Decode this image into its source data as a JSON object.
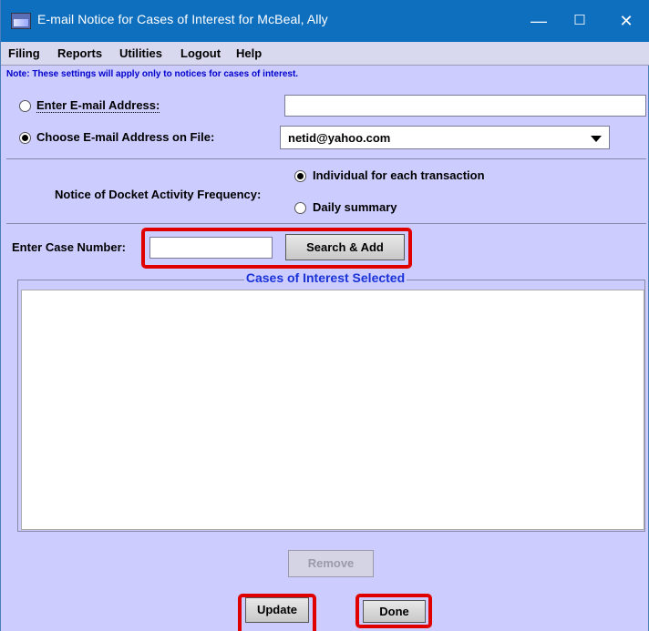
{
  "window": {
    "title": "E-mail Notice for Cases of Interest for McBeal, Ally",
    "controls": {
      "minimize": "—",
      "maximize": "☐",
      "close": "✕"
    }
  },
  "menu": [
    "Filing",
    "Reports",
    "Utilities",
    "Logout",
    "Help"
  ],
  "note": "Note: These settings will apply only to notices for cases of interest.",
  "email": {
    "enter_label": "Enter E-mail Address:",
    "enter_value": "",
    "enter_selected": false,
    "choose_label": "Choose E-mail Address on File:",
    "choose_selected": true,
    "selected_address": "netid@yahoo.com"
  },
  "frequency": {
    "label": "Notice of Docket Activity Frequency:",
    "options": [
      {
        "label": "Individual for each transaction",
        "selected": true
      },
      {
        "label": "Daily summary",
        "selected": false
      }
    ]
  },
  "case": {
    "label": "Enter Case Number:",
    "value": "",
    "search_button": "Search & Add"
  },
  "cases_panel": {
    "title": "Cases of Interest Selected",
    "items": []
  },
  "buttons": {
    "remove": "Remove",
    "update": "Update",
    "done": "Done"
  },
  "colors": {
    "background": "#ccccff",
    "titlebar": "#0f6fbf",
    "note_text": "#0000cc",
    "panel_title": "#1a33d6",
    "highlight": "#e00000"
  }
}
